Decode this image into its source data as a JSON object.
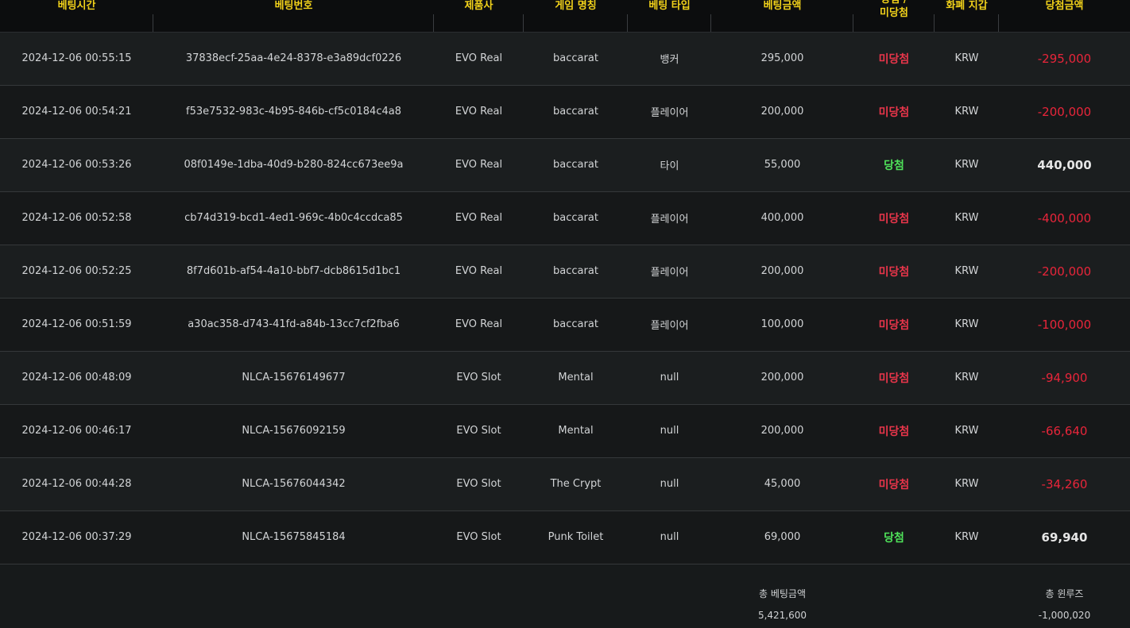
{
  "headers": {
    "bet_time": "베팅시간",
    "bet_id": "베팅번호",
    "provider": "제품사",
    "game_name": "게임 명칭",
    "bet_type": "베팅 타입",
    "bet_amount": "베팅금액",
    "result_line1": "당첨 /",
    "result_line2": "미당첨",
    "currency": "화폐 지갑",
    "win_amount": "당첨금액"
  },
  "rows": [
    {
      "time": "2024-12-06 00:55:15",
      "id": "37838ecf-25aa-4e24-8378-e3a89dcf0226",
      "provider": "EVO Real",
      "game": "baccarat",
      "type": "뱅커",
      "amount": "295,000",
      "result": "미당첨",
      "currency": "KRW",
      "win": "-295,000"
    },
    {
      "time": "2024-12-06 00:54:21",
      "id": "f53e7532-983c-4b95-846b-cf5c0184c4a8",
      "provider": "EVO Real",
      "game": "baccarat",
      "type": "플레이어",
      "amount": "200,000",
      "result": "미당첨",
      "currency": "KRW",
      "win": "-200,000"
    },
    {
      "time": "2024-12-06 00:53:26",
      "id": "08f0149e-1dba-40d9-b280-824cc673ee9a",
      "provider": "EVO Real",
      "game": "baccarat",
      "type": "타이",
      "amount": "55,000",
      "result": "당첨",
      "currency": "KRW",
      "win": "440,000"
    },
    {
      "time": "2024-12-06 00:52:58",
      "id": "cb74d319-bcd1-4ed1-969c-4b0c4ccdca85",
      "provider": "EVO Real",
      "game": "baccarat",
      "type": "플레이어",
      "amount": "400,000",
      "result": "미당첨",
      "currency": "KRW",
      "win": "-400,000"
    },
    {
      "time": "2024-12-06 00:52:25",
      "id": "8f7d601b-af54-4a10-bbf7-dcb8615d1bc1",
      "provider": "EVO Real",
      "game": "baccarat",
      "type": "플레이어",
      "amount": "200,000",
      "result": "미당첨",
      "currency": "KRW",
      "win": "-200,000"
    },
    {
      "time": "2024-12-06 00:51:59",
      "id": "a30ac358-d743-41fd-a84b-13cc7cf2fba6",
      "provider": "EVO Real",
      "game": "baccarat",
      "type": "플레이어",
      "amount": "100,000",
      "result": "미당첨",
      "currency": "KRW",
      "win": "-100,000"
    },
    {
      "time": "2024-12-06 00:48:09",
      "id": "NLCA-15676149677",
      "provider": "EVO Slot",
      "game": "Mental",
      "type": "null",
      "amount": "200,000",
      "result": "미당첨",
      "currency": "KRW",
      "win": "-94,900"
    },
    {
      "time": "2024-12-06 00:46:17",
      "id": "NLCA-15676092159",
      "provider": "EVO Slot",
      "game": "Mental",
      "type": "null",
      "amount": "200,000",
      "result": "미당첨",
      "currency": "KRW",
      "win": "-66,640"
    },
    {
      "time": "2024-12-06 00:44:28",
      "id": "NLCA-15676044342",
      "provider": "EVO Slot",
      "game": "The Crypt",
      "type": "null",
      "amount": "45,000",
      "result": "미당첨",
      "currency": "KRW",
      "win": "-34,260"
    },
    {
      "time": "2024-12-06 00:37:29",
      "id": "NLCA-15675845184",
      "provider": "EVO Slot",
      "game": "Punk Toilet",
      "type": "null",
      "amount": "69,000",
      "result": "당첨",
      "currency": "KRW",
      "win": "69,940"
    }
  ],
  "totals": {
    "bet_label": "총 베팅금액",
    "bet_value": "5,421,600",
    "winloss_label": "총 윈루즈",
    "winloss_value": "-1,000,020"
  },
  "colors": {
    "header_text": "#f2d21a",
    "lose": "#e8354a",
    "win": "#4fe35a",
    "negative_amount": "#e8253a"
  }
}
